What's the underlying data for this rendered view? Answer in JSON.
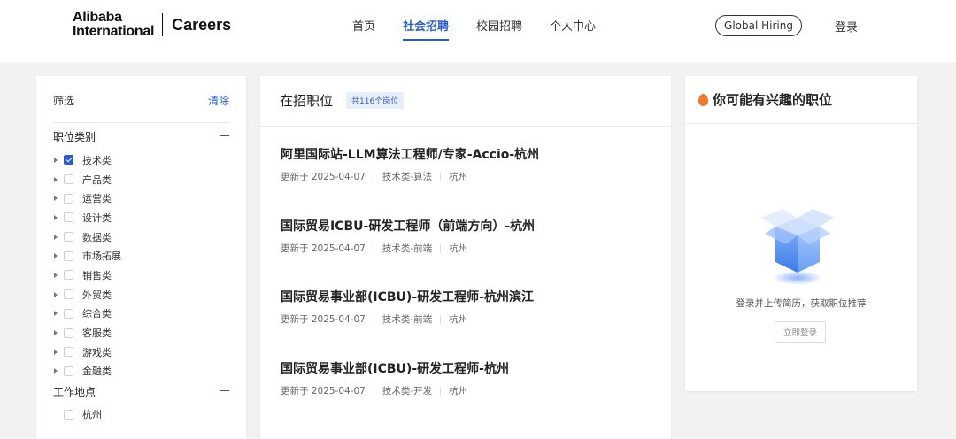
{
  "header": {
    "logo_line1": "Alibaba",
    "logo_line2": "International",
    "logo_suffix": "Careers",
    "nav": [
      "首页",
      "社会招聘",
      "校园招聘",
      "个人中心"
    ],
    "active_nav": "社会招聘",
    "global_hiring": "Global Hiring",
    "login": "登录"
  },
  "filter": {
    "title": "筛选",
    "clear": "清除",
    "category_title": "职位类别",
    "categories": [
      {
        "label": "技术类",
        "checked": true
      },
      {
        "label": "产品类",
        "checked": false
      },
      {
        "label": "运营类",
        "checked": false
      },
      {
        "label": "设计类",
        "checked": false
      },
      {
        "label": "数据类",
        "checked": false
      },
      {
        "label": "市场拓展",
        "checked": false
      },
      {
        "label": "销售类",
        "checked": false
      },
      {
        "label": "外贸类",
        "checked": false
      },
      {
        "label": "综合类",
        "checked": false
      },
      {
        "label": "客服类",
        "checked": false
      },
      {
        "label": "游戏类",
        "checked": false
      },
      {
        "label": "金融类",
        "checked": false
      }
    ],
    "location_title": "工作地点",
    "locations": [
      {
        "label": "杭州",
        "checked": false
      }
    ]
  },
  "jobs": {
    "title": "在招职位",
    "count_badge": "共116个岗位",
    "items": [
      {
        "title": "阿里国际站-LLM算法工程师/专家-Accio-杭州",
        "updated": "更新于 2025-04-07",
        "category": "技术类-算法",
        "city": "杭州"
      },
      {
        "title": "国际贸易ICBU-研发工程师（前端方向）-杭州",
        "updated": "更新于 2025-04-07",
        "category": "技术类-前端",
        "city": "杭州"
      },
      {
        "title": "国际贸易事业部(ICBU)-研发工程师-杭州滨江",
        "updated": "更新于 2025-04-07",
        "category": "技术类-前端",
        "city": "杭州"
      },
      {
        "title": "国际贸易事业部(ICBU)-研发工程师-杭州",
        "updated": "更新于 2025-04-07",
        "category": "技术类-开发",
        "city": "杭州"
      }
    ]
  },
  "recommend": {
    "title": "你可能有兴趣的职位",
    "prompt": "登录并上传简历，获取职位推荐",
    "button": "立即登录"
  },
  "colors": {
    "accent": "#2a5bd7",
    "flame": "#f07a2a"
  }
}
